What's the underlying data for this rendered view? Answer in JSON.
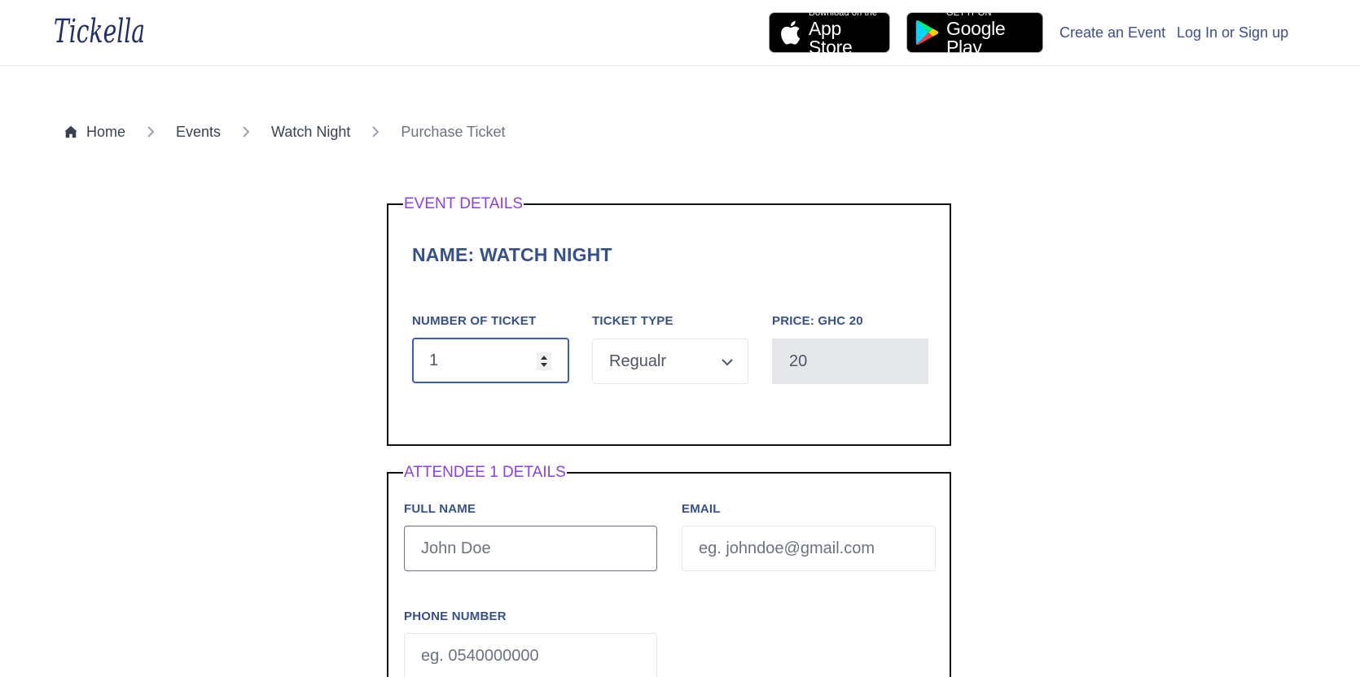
{
  "header": {
    "logo_text": "Tickella",
    "app_store": {
      "small": "Download on the",
      "big": "App Store"
    },
    "google_play": {
      "small": "GET IT ON",
      "big": "Google Play"
    },
    "create_event": "Create an Event",
    "login": "Log In or Sign up"
  },
  "breadcrumb": {
    "home": "Home",
    "events": "Events",
    "event": "Watch Night",
    "current": "Purchase Ticket"
  },
  "event_details": {
    "legend": "EVENT DETAILS",
    "name": "NAME: WATCH NIGHT",
    "tickets_label": "NUMBER OF TICKET",
    "tickets_value": "1",
    "type_label": "TICKET TYPE",
    "type_value": "Regualr",
    "price_label": "PRICE: GHC 20",
    "price_value": "20"
  },
  "attendee": {
    "legend": "ATTENDEE 1 DETAILS",
    "full_name_label": "FULL NAME",
    "full_name_placeholder": "John Doe",
    "email_label": "EMAIL",
    "email_placeholder": "eg. johndoe@gmail.com",
    "phone_label": "PHONE NUMBER",
    "phone_placeholder": "eg. 0540000000"
  },
  "colors": {
    "label_blue": "#36508c",
    "legend_purple": "#8b3fe0",
    "focus_blue": "#3b5bc9",
    "logo_navy": "#1e2f6b"
  },
  "icons": [
    "apple-icon",
    "google-play-icon",
    "home-icon",
    "chevron-right-icon",
    "number-spinner-icon",
    "chevron-down-icon"
  ]
}
